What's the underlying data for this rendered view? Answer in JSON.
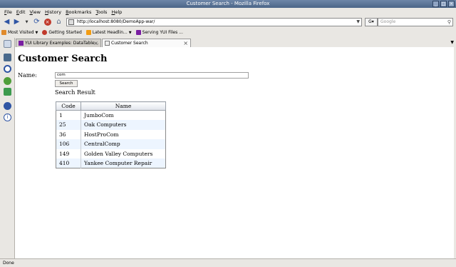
{
  "window": {
    "title": "Customer Search - Mozilla Firefox"
  },
  "menu": [
    "File",
    "Edit",
    "View",
    "History",
    "Bookmarks",
    "Tools",
    "Help"
  ],
  "nav": {
    "url": "http://localhost:8080/DemoApp-war/",
    "search_placeholder": "Google"
  },
  "bookmarks": [
    {
      "label": "Most Visited",
      "color": "#e08a2b",
      "dropdown": true
    },
    {
      "label": "Getting Started",
      "color": "#c0392b",
      "dropdown": false
    },
    {
      "label": "Latest Headlin...",
      "color": "#f39c12",
      "dropdown": true
    },
    {
      "label": "Serving YUI Files ...",
      "color": "#7a1fa2",
      "dropdown": false
    }
  ],
  "tabs": [
    {
      "label": "YUI Library Examples: DataTable...",
      "active": false
    },
    {
      "label": "Customer Search",
      "active": true
    }
  ],
  "page": {
    "title": "Customer Search",
    "name_label": "Name:",
    "name_value": "com",
    "search_button": "Search",
    "search_result_label": "Search Result",
    "table": {
      "headers": [
        "Code",
        "Name"
      ],
      "rows": [
        {
          "code": "1",
          "name": "JumboCom"
        },
        {
          "code": "25",
          "name": "Oak Computers"
        },
        {
          "code": "36",
          "name": "HostProCom"
        },
        {
          "code": "106",
          "name": "CentralComp"
        },
        {
          "code": "149",
          "name": "Golden Valley Computers"
        },
        {
          "code": "410",
          "name": "Yankee Computer Repair"
        }
      ]
    }
  },
  "status": {
    "text": "Done"
  },
  "colors": {
    "titlebar": "#4b6587",
    "table_odd_row": "#edf5ff",
    "link_blue": "#2f55a4"
  }
}
